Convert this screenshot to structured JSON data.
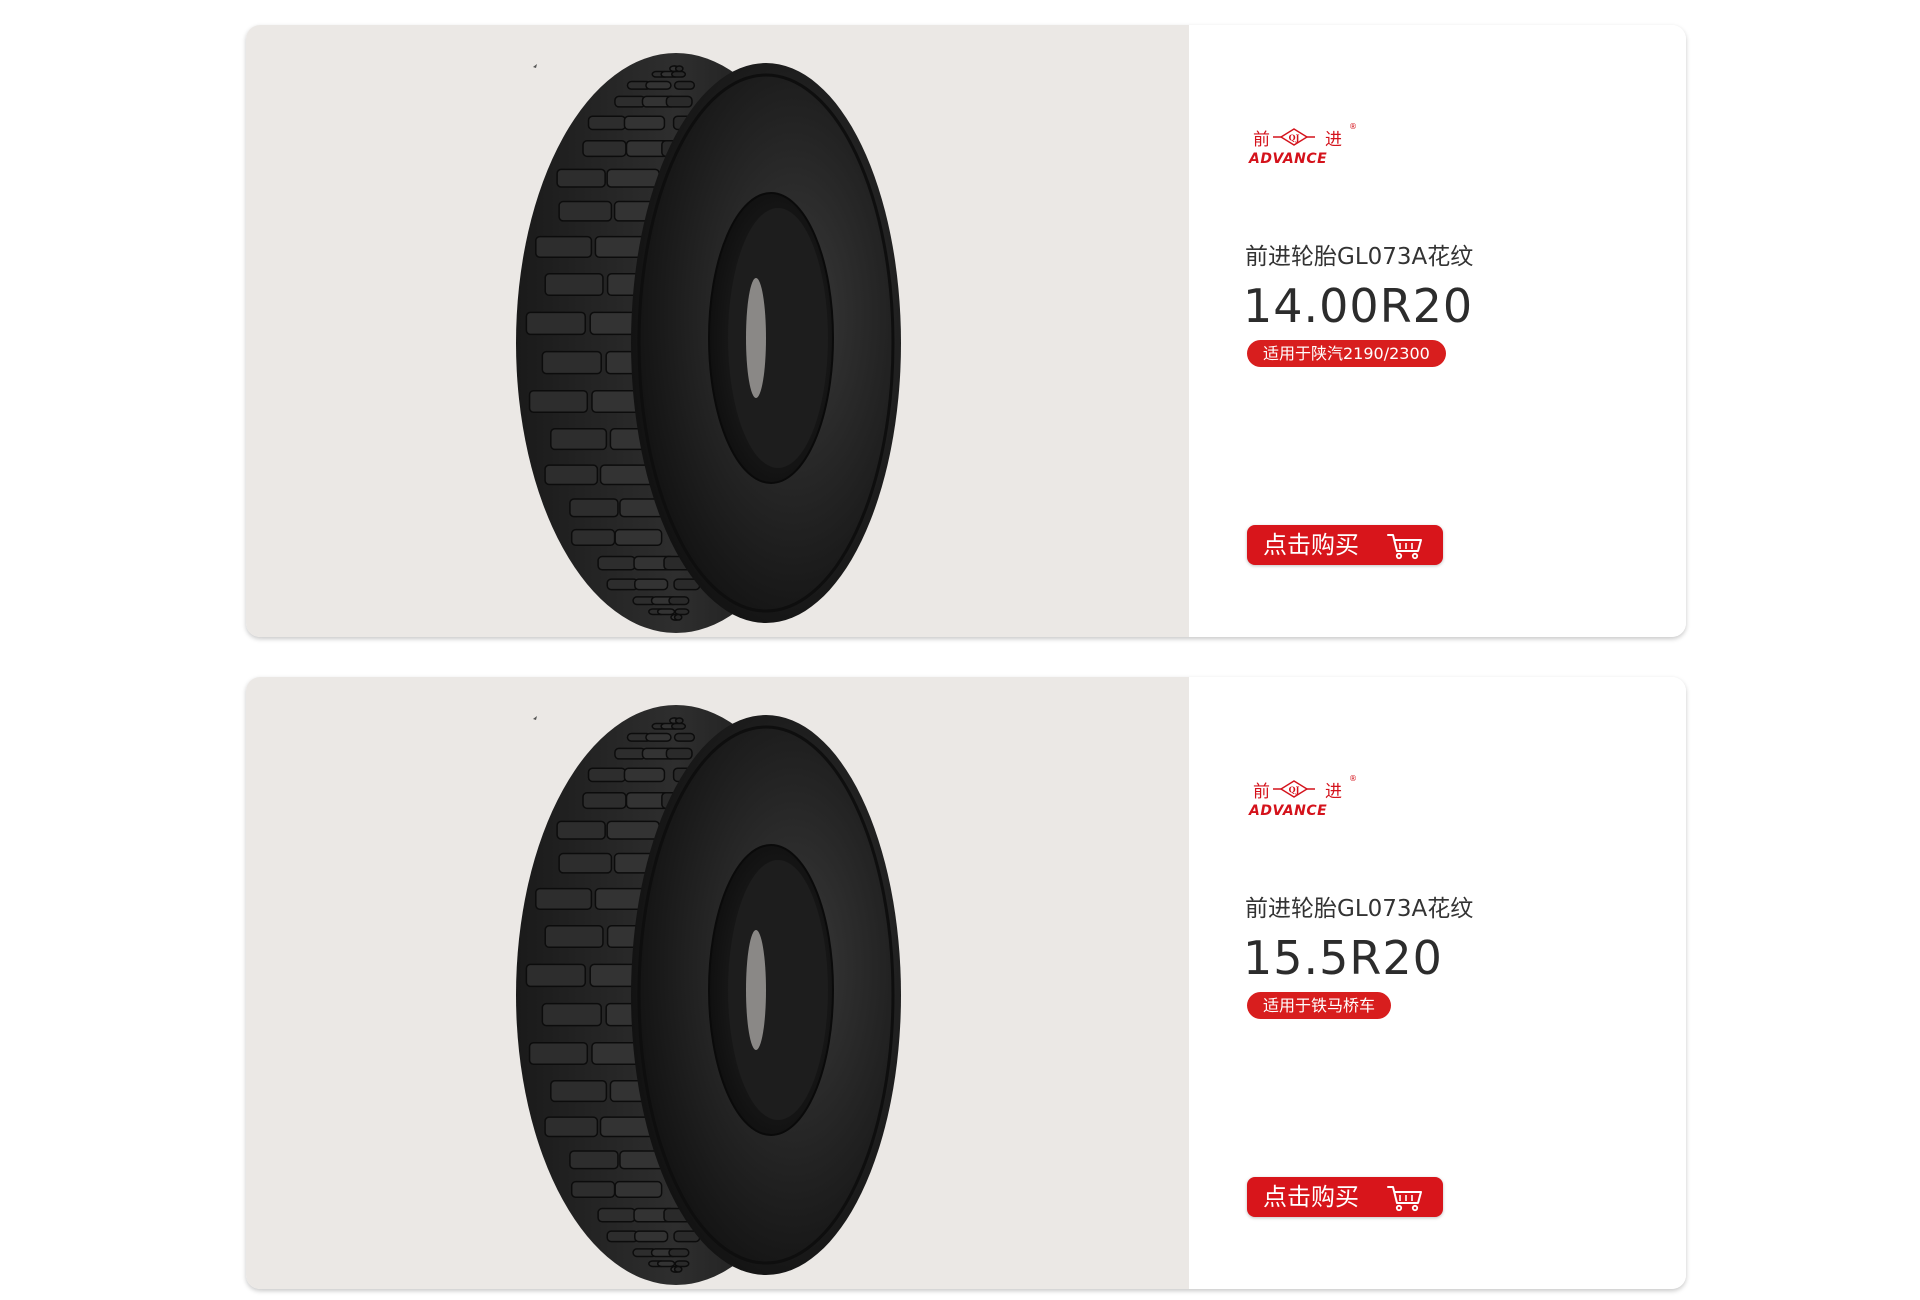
{
  "products": [
    {
      "brand_cn_1": "前",
      "brand_cn_2": "进",
      "brand_mark": "QJ",
      "brand_en": "ADVANCE",
      "title": "前进轮胎GL073A花纹",
      "size": "14.00R20",
      "fitment": "适用于陕汽2190/2300",
      "buy_label": "点击购买",
      "image_icon": "tire-image",
      "cart_icon": "shopping-cart-icon"
    },
    {
      "brand_cn_1": "前",
      "brand_cn_2": "进",
      "brand_mark": "QJ",
      "brand_en": "ADVANCE",
      "title": "前进轮胎GL073A花纹",
      "size": "15.5R20",
      "fitment": "适用于铁马桥车",
      "buy_label": "点击购买",
      "image_icon": "tire-image",
      "cart_icon": "shopping-cart-icon"
    }
  ],
  "colors": {
    "accent": "#d8151b",
    "image_bg": "#ebe8e5",
    "text": "#333333"
  }
}
